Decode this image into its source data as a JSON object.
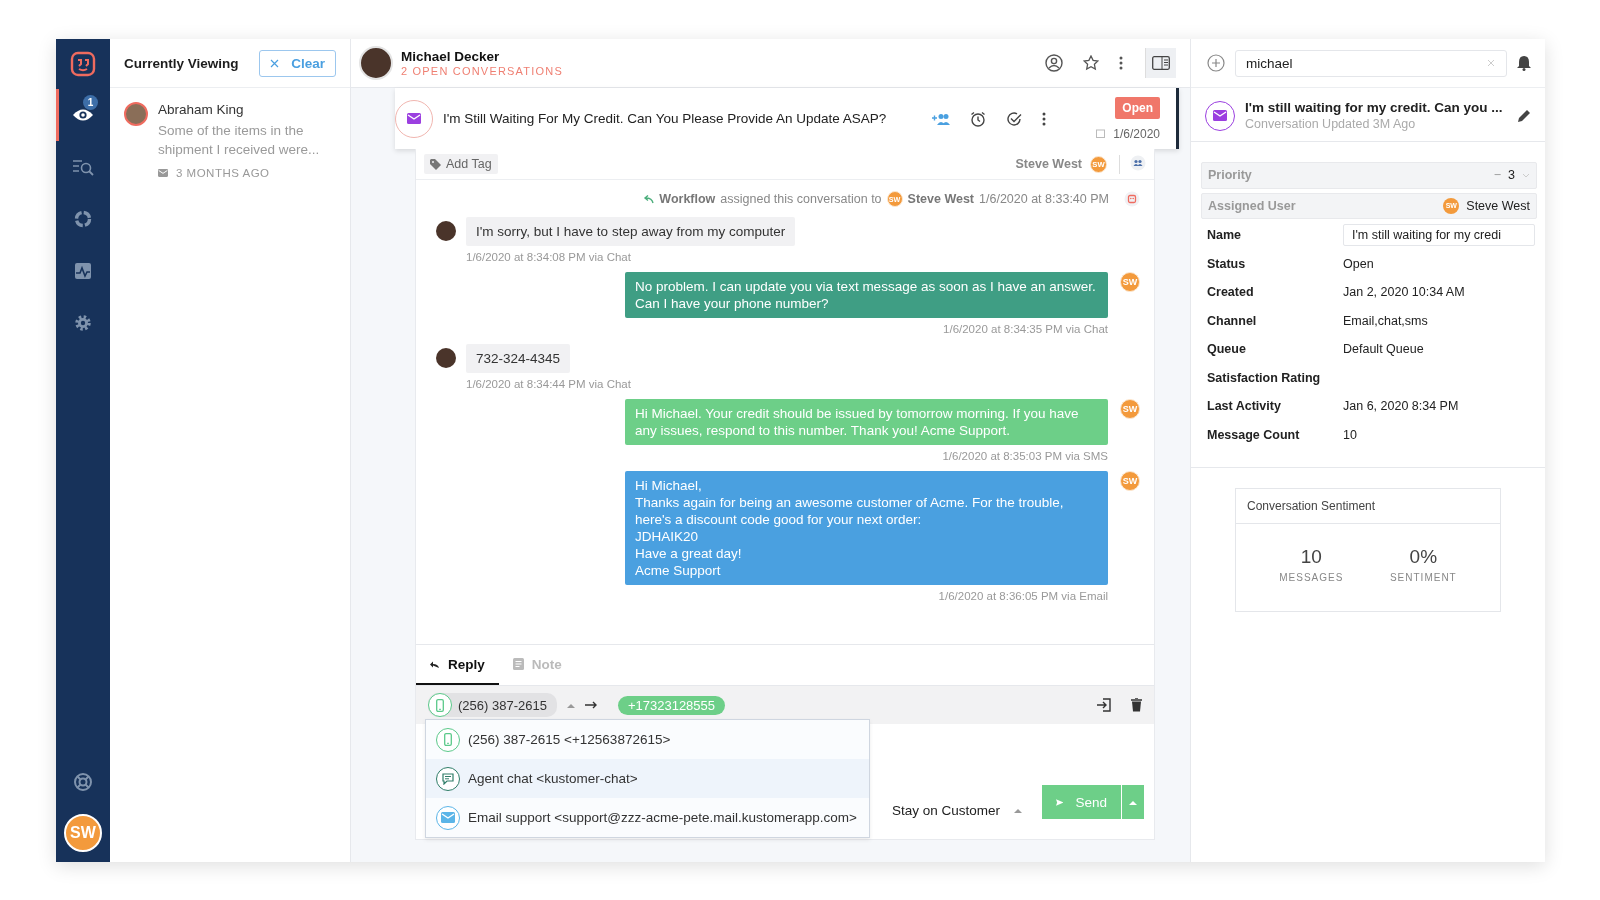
{
  "nav": {
    "items": [
      {
        "kind": "eye",
        "badge": "1",
        "selected": true
      },
      {
        "kind": "list-search",
        "selected": false
      },
      {
        "kind": "donut",
        "selected": false
      },
      {
        "kind": "activity",
        "selected": false
      },
      {
        "kind": "settings",
        "selected": false
      }
    ],
    "bottom": [
      {
        "kind": "help",
        "selected": false
      }
    ],
    "avatar": "SW"
  },
  "viewing": {
    "title": "Currently Viewing",
    "clear_button": "Clear",
    "items": [
      {
        "name": "Abraham King",
        "preview": "Some of the items in the shipment I received were...",
        "time": "3 MONTHS AGO"
      }
    ]
  },
  "customer": {
    "name": "Michael Decker",
    "subtitle": "2 OPEN CONVERSATIONS"
  },
  "conversation": {
    "title": "I'm Still Waiting For My Credit. Can You Please Provide An Update ASAP?",
    "status": "Open",
    "date": "1/6/2020",
    "add_tag": "Add Tag",
    "assignee": "Steve West",
    "assignee_initials": "SW"
  },
  "timeline": [
    {
      "kind": "event",
      "actor": "Workflow",
      "action": "assigned this conversation to",
      "initials": "SW",
      "target": "Steve West",
      "time": "1/6/2020 at 8:33:40 PM"
    },
    {
      "kind": "inbound",
      "lines": [
        "I'm sorry, but I have to step away from my computer"
      ],
      "meta": "1/6/2020 at 8:34:08 PM via Chat"
    },
    {
      "kind": "outbound",
      "color": "#3f9e84",
      "initials": "SW",
      "lines": [
        "No problem. I can update you via text message as soon as I have an answer. Can I have your phone number?"
      ],
      "meta": "1/6/2020 at 8:34:35 PM via Chat"
    },
    {
      "kind": "inbound",
      "lines": [
        "732-324-4345"
      ],
      "meta": "1/6/2020 at 8:34:44 PM via Chat"
    },
    {
      "kind": "outbound",
      "color": "#6dcf88",
      "initials": "SW",
      "lines": [
        "Hi Michael. Your credit should be issued by tomorrow morning. If you have any issues, respond to this number. Thank you! Acme Support."
      ],
      "meta": "1/6/2020 at 8:35:03 PM via SMS"
    },
    {
      "kind": "outbound",
      "color": "#4aa0e0",
      "initials": "SW",
      "lines": [
        "Hi Michael,",
        "Thanks again for being an awesome customer of Acme. For the trouble, here's a discount code good for your next order:",
        "JDHAIK20",
        "Have a great day!",
        "Acme Support"
      ],
      "meta": "1/6/2020 at 8:36:05 PM via Email"
    }
  ],
  "composer": {
    "tabs": [
      {
        "label": "Reply",
        "kind": "reply",
        "selected": true
      },
      {
        "label": "Note",
        "kind": "note",
        "selected": false
      }
    ],
    "from": "(256) 387-2615",
    "to": "+17323128555",
    "options": [
      {
        "kind": "phone",
        "label": "(256) 387-2615 <+12563872615>",
        "selected": false
      },
      {
        "kind": "chat",
        "label": "Agent chat <kustomer-chat>",
        "selected": true
      },
      {
        "kind": "email",
        "label": "Email support <support@zzz-acme-pete.mail.kustomerapp.com>",
        "selected": false
      }
    ],
    "stay": "Stay on Customer",
    "send": "Send"
  },
  "details": {
    "search": {
      "value": "michael"
    },
    "title": "I'm still waiting for my credit. Can you ...",
    "subtitle": "Conversation Updated 3M Ago",
    "fields": [
      {
        "kind": "number",
        "label": "Priority",
        "decrement": "−",
        "value": "3",
        "disabled": true
      },
      {
        "kind": "user",
        "label": "Assigned User",
        "value": "Steve West",
        "initials": "SW",
        "disabled": true
      },
      {
        "kind": "input",
        "label": "Name",
        "value": "I'm still waiting for my credi",
        "disabled": false
      },
      {
        "kind": "text",
        "label": "Status",
        "value": "Open",
        "disabled": false
      },
      {
        "kind": "text",
        "label": "Created",
        "value": "Jan 2, 2020 10:34 AM",
        "disabled": false
      },
      {
        "kind": "text",
        "label": "Channel",
        "value": "Email,chat,sms",
        "disabled": false
      },
      {
        "kind": "text",
        "label": "Queue",
        "value": "Default Queue",
        "disabled": false
      },
      {
        "kind": "text",
        "label": "Satisfaction Rating",
        "disabled": false
      },
      {
        "kind": "text",
        "label": "Last Activity",
        "value": "Jan 6, 2020 8:34 PM",
        "disabled": false
      },
      {
        "kind": "text",
        "label": "Message Count",
        "value": "10",
        "disabled": false
      }
    ],
    "sentiment": {
      "title": "Conversation Sentiment",
      "stats": [
        {
          "value": "10",
          "label": "MESSAGES"
        },
        {
          "value": "0%",
          "label": "SENTIMENT"
        }
      ]
    }
  }
}
